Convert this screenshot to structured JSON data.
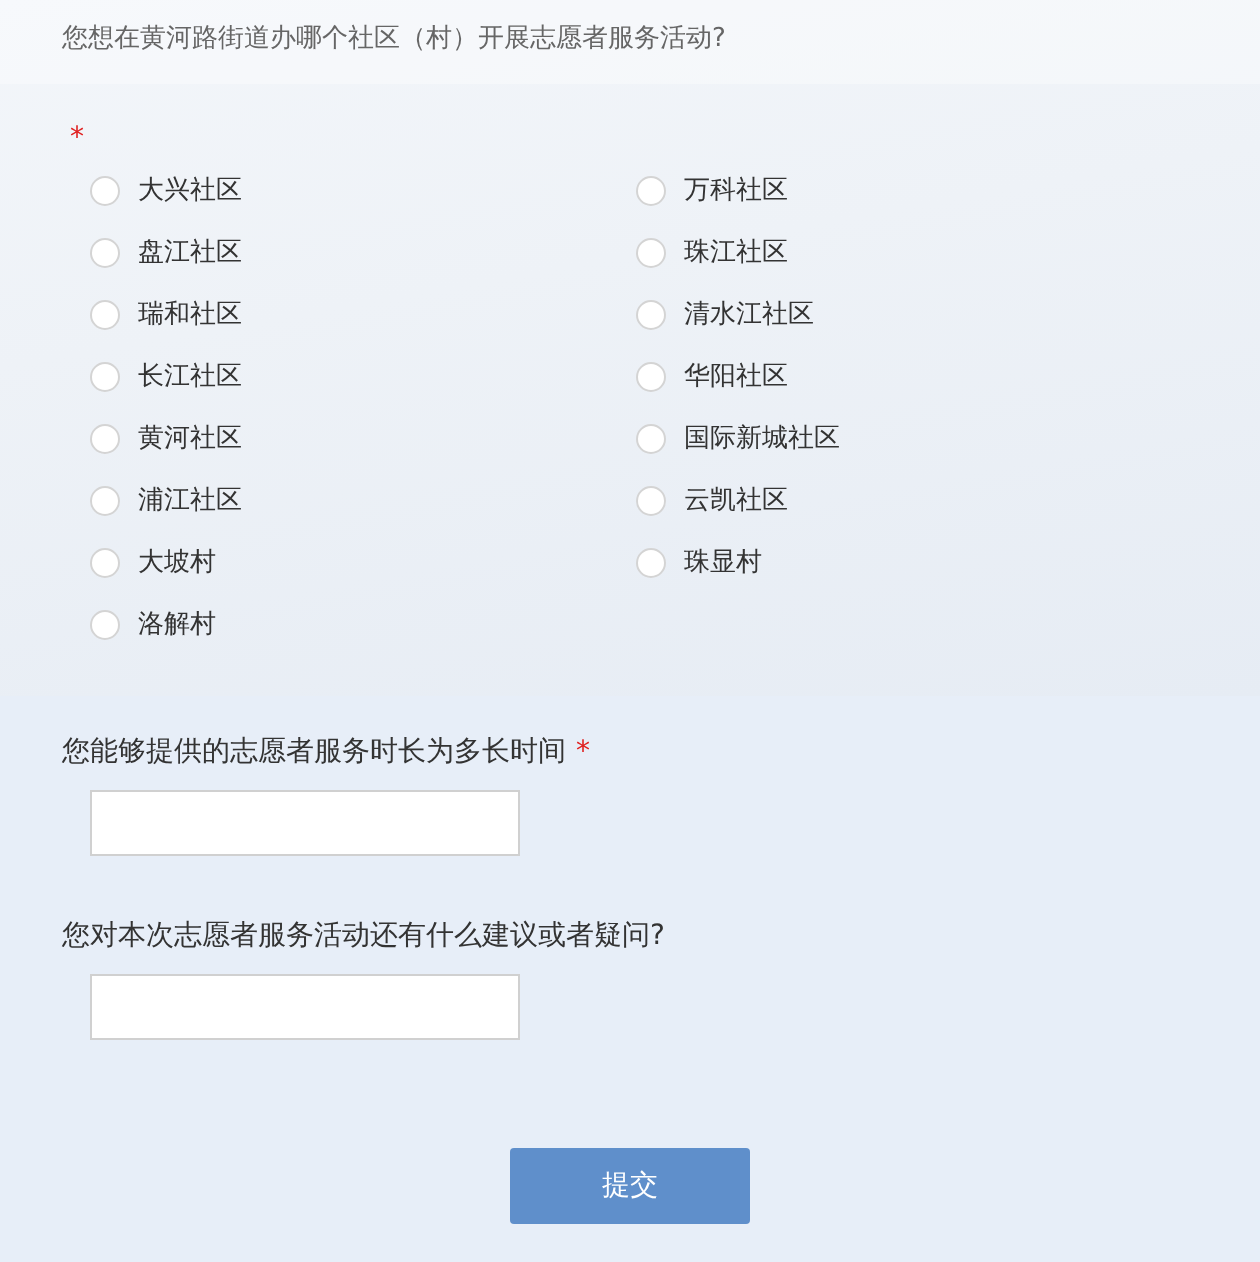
{
  "question": {
    "title": "您想在黄河路街道办哪个社区（村）开展志愿者服务活动?",
    "required_mark": "*",
    "options": [
      {
        "label": "大兴社区",
        "selected": false
      },
      {
        "label": "万科社区",
        "selected": false
      },
      {
        "label": "盘江社区",
        "selected": false
      },
      {
        "label": "珠江社区",
        "selected": false
      },
      {
        "label": "瑞和社区",
        "selected": false
      },
      {
        "label": "清水江社区",
        "selected": false
      },
      {
        "label": "长江社区",
        "selected": false
      },
      {
        "label": "华阳社区",
        "selected": false
      },
      {
        "label": "黄河社区",
        "selected": false
      },
      {
        "label": "国际新城社区",
        "selected": false
      },
      {
        "label": "浦江社区",
        "selected": false
      },
      {
        "label": "云凯社区",
        "selected": false
      },
      {
        "label": "大坡村",
        "selected": false
      },
      {
        "label": "珠显村",
        "selected": false
      },
      {
        "label": "洛解村",
        "selected": false
      }
    ]
  },
  "fields": [
    {
      "label": "您能够提供的志愿者服务时长为多长时间",
      "required_mark": "*"
    },
    {
      "label": "您对本次志愿者服务活动还有什么建议或者疑问?"
    }
  ],
  "submit": "提交"
}
